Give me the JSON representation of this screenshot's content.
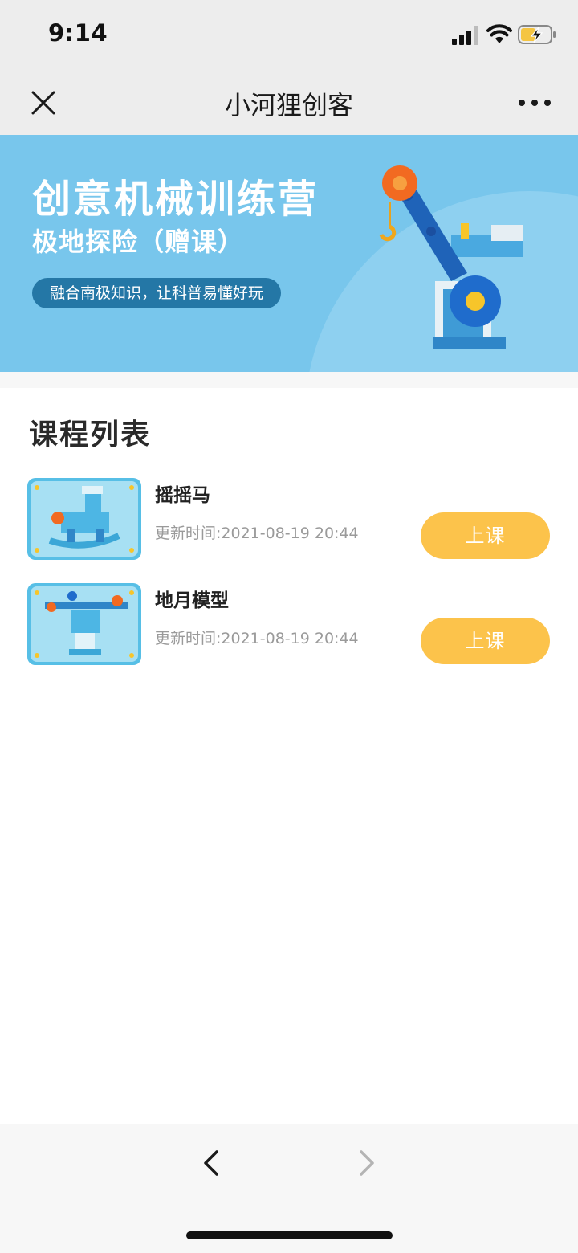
{
  "status_bar": {
    "time": "9:14",
    "icons": [
      "cellular-signal-icon",
      "wifi-icon",
      "battery-charging-icon"
    ],
    "battery_color": "#f5c542"
  },
  "nav_bar": {
    "title": "小河狸创客",
    "close_icon": "close-icon",
    "more_icon": "more-icon"
  },
  "banner": {
    "title": "创意机械训练营",
    "subtitle": "极地探险（赠课）",
    "tagline": "融合南极知识，让科普易懂好玩",
    "background_color": "#78c6ec",
    "pill_color": "#2477a6"
  },
  "course_list": {
    "title": "课程列表",
    "items": [
      {
        "name": "摇摇马",
        "updated": "更新时间:2021-08-19 20:44",
        "button_label": "上课"
      },
      {
        "name": "地月模型",
        "updated": "更新时间:2021-08-19 20:44",
        "button_label": "上课"
      }
    ],
    "button_color": "#fcc34b"
  },
  "bottom_bar": {
    "back_icon": "chevron-left-icon",
    "forward_icon": "chevron-right-icon"
  }
}
